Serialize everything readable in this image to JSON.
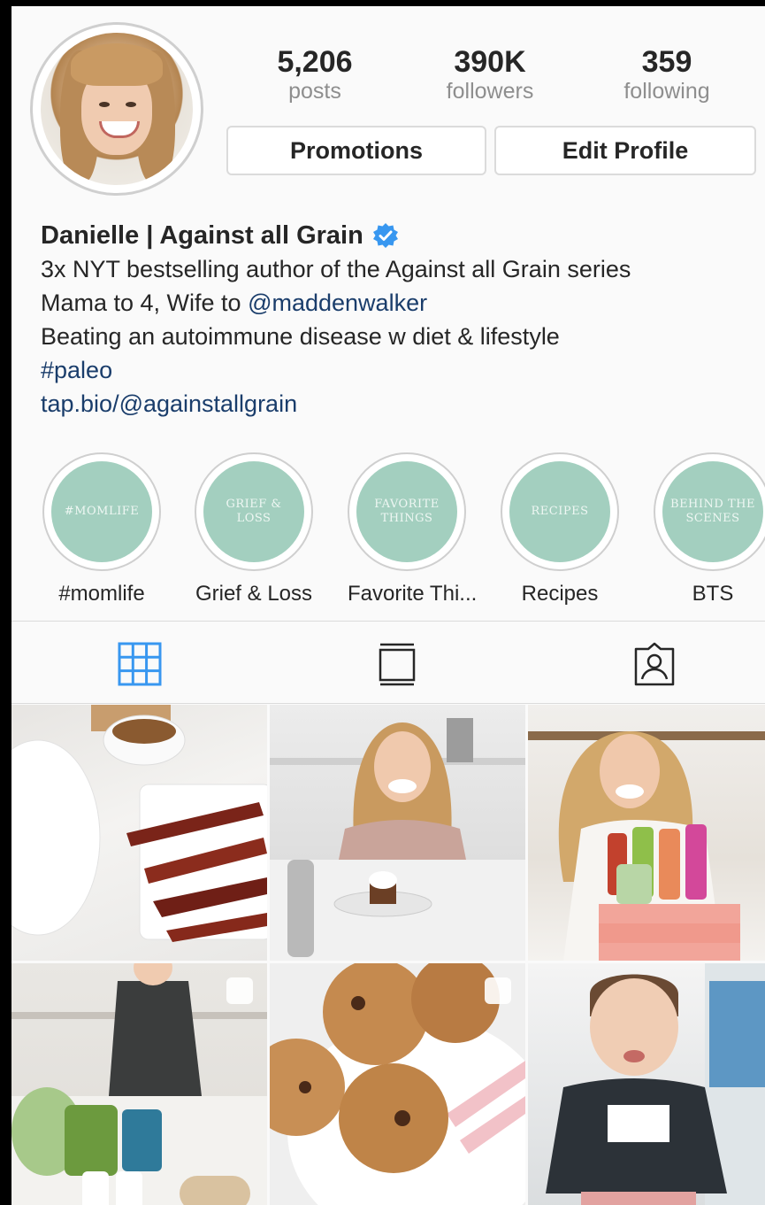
{
  "profile": {
    "stats": [
      {
        "value": "5,206",
        "label": "posts"
      },
      {
        "value": "390K",
        "label": "followers"
      },
      {
        "value": "359",
        "label": "following"
      }
    ],
    "buttons": {
      "promotions": "Promotions",
      "edit_profile": "Edit Profile"
    },
    "name": "Danielle | Against all Grain",
    "verified": true,
    "bio": {
      "line1": "3x NYT bestselling author of the Against all Grain series",
      "line2_prefix": "Mama to 4, Wife to ",
      "line2_mention": "@maddenwalker",
      "line3": "Beating an autoimmune disease w diet & lifestyle",
      "hashtag": "#paleo",
      "link": "tap.bio/@againstallgrain"
    }
  },
  "highlights": [
    {
      "cover_text": "#MOMLIFE",
      "label": "#momlife"
    },
    {
      "cover_text": "GRIEF & LOSS",
      "label": "Grief & Loss"
    },
    {
      "cover_text": "FAVORITE THINGS",
      "label": "Favorite Thi..."
    },
    {
      "cover_text": "RECIPES",
      "label": "Recipes"
    },
    {
      "cover_text": "BEHIND THE SCENES",
      "label": "BTS"
    }
  ],
  "tabs": [
    {
      "icon": "grid-icon",
      "active": true
    },
    {
      "icon": "feed-icon",
      "active": false
    },
    {
      "icon": "tagged-icon",
      "active": false
    }
  ],
  "colors": {
    "active_tab": "#3897f0",
    "verified_badge": "#3897f0",
    "highlight_fill": "#a3cfbf",
    "link": "#1a3d6b"
  }
}
